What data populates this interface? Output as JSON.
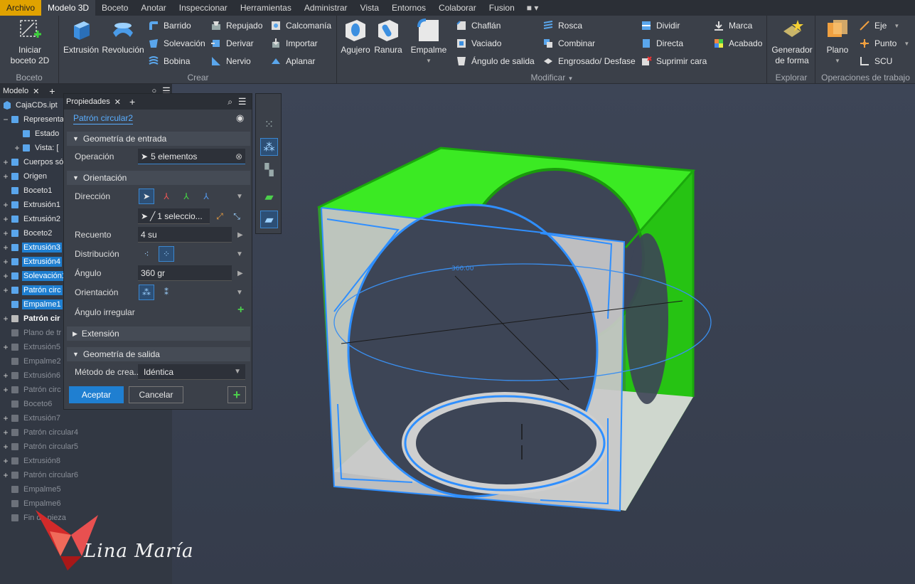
{
  "menu": {
    "items": [
      "Archivo",
      "Modelo 3D",
      "Boceto",
      "Anotar",
      "Inspeccionar",
      "Herramientas",
      "Administrar",
      "Vista",
      "Entornos",
      "Colaborar",
      "Fusion"
    ],
    "active": "Modelo 3D"
  },
  "ribbon": {
    "boceto": {
      "label": "Boceto",
      "start_sketch_line1": "Iniciar",
      "start_sketch_line2": "boceto 2D"
    },
    "crear": {
      "label": "Crear",
      "extrusion": "Extrusión",
      "revolucion": "Revolución",
      "barrido": "Barrido",
      "solevacion": "Solevación",
      "bobina": "Bobina",
      "repujado": "Repujado",
      "derivar": "Derivar",
      "nervio": "Nervio",
      "calcomania": "Calcomanía",
      "importar": "Importar",
      "aplanar": "Aplanar"
    },
    "modificar": {
      "label": "Modificar",
      "agujero": "Agujero",
      "ranura": "Ranura",
      "empalme": "Empalme",
      "chaflan": "Chaflán",
      "vaciado": "Vaciado",
      "angulo_salida": "Ángulo de salida",
      "rosca": "Rosca",
      "combinar": "Combinar",
      "engrosado": "Engrosado/ Desfase",
      "dividir": "Dividir",
      "directa": "Directa",
      "suprimir_cara": "Suprimir cara",
      "marca": "Marca",
      "acabado": "Acabado"
    },
    "explorar": {
      "label": "Explorar",
      "generador_line1": "Generador",
      "generador_line2": "de forma"
    },
    "trabajo": {
      "label": "Operaciones de trabajo",
      "plano": "Plano",
      "eje": "Eje",
      "punto": "Punto",
      "scu": "SCU"
    }
  },
  "browser": {
    "tab": "Modelo",
    "file": "CajaCDs.ipt",
    "rows": [
      {
        "exp": "−",
        "indent": 0,
        "label": "Representa",
        "state": "normal"
      },
      {
        "exp": "",
        "indent": 1,
        "label": "Estado",
        "state": "normal"
      },
      {
        "exp": "+",
        "indent": 1,
        "label": "Vista: [",
        "state": "normal"
      },
      {
        "exp": "+",
        "indent": 0,
        "label": "Cuerpos só",
        "state": "normal"
      },
      {
        "exp": "+",
        "indent": 0,
        "label": "Origen",
        "state": "normal"
      },
      {
        "exp": "",
        "indent": 0,
        "label": "Boceto1",
        "state": "normal"
      },
      {
        "exp": "+",
        "indent": 0,
        "label": "Extrusión1",
        "state": "normal"
      },
      {
        "exp": "+",
        "indent": 0,
        "label": "Extrusión2",
        "state": "normal"
      },
      {
        "exp": "+",
        "indent": 0,
        "label": "Boceto2",
        "state": "normal"
      },
      {
        "exp": "+",
        "indent": 0,
        "label": "Extrusión3",
        "state": "sel"
      },
      {
        "exp": "+",
        "indent": 0,
        "label": "Extrusión4",
        "state": "sel"
      },
      {
        "exp": "+",
        "indent": 0,
        "label": "Solevación1",
        "state": "sel"
      },
      {
        "exp": "+",
        "indent": 0,
        "label": "Patrón circ",
        "state": "sel"
      },
      {
        "exp": "",
        "indent": 0,
        "label": "Empalme1",
        "state": "sel"
      },
      {
        "exp": "+",
        "indent": 0,
        "label": "Patrón cir",
        "state": "bold"
      },
      {
        "exp": "",
        "indent": 0,
        "label": "Plano de tr",
        "state": "dim"
      },
      {
        "exp": "+",
        "indent": 0,
        "label": "Extrusión5",
        "state": "dim"
      },
      {
        "exp": "",
        "indent": 0,
        "label": "Empalme2",
        "state": "dim"
      },
      {
        "exp": "+",
        "indent": 0,
        "label": "Extrusión6",
        "state": "dim"
      },
      {
        "exp": "+",
        "indent": 0,
        "label": "Patrón circ",
        "state": "dim"
      },
      {
        "exp": "",
        "indent": 0,
        "label": "Boceto6",
        "state": "dim"
      },
      {
        "exp": "+",
        "indent": 0,
        "label": "Extrusión7",
        "state": "dim"
      },
      {
        "exp": "+",
        "indent": 0,
        "label": "Patrón circular4",
        "state": "dim"
      },
      {
        "exp": "+",
        "indent": 0,
        "label": "Patrón circular5",
        "state": "dim"
      },
      {
        "exp": "+",
        "indent": 0,
        "label": "Extrusión8",
        "state": "dim"
      },
      {
        "exp": "+",
        "indent": 0,
        "label": "Patrón circular6",
        "state": "dim"
      },
      {
        "exp": "",
        "indent": 0,
        "label": "Empalme5",
        "state": "dim"
      },
      {
        "exp": "",
        "indent": 0,
        "label": "Empalme6",
        "state": "dim"
      },
      {
        "exp": "",
        "indent": 0,
        "label": "Fin de pieza",
        "state": "dim"
      }
    ]
  },
  "properties": {
    "tab": "Propiedades",
    "feature_name": "Patrón circular2",
    "input_section": "Geometría de entrada",
    "operation_label": "Operación",
    "operation_value": "5 elementos",
    "orientation_section": "Orientación",
    "direction_label": "Dirección",
    "axis_value": "1 seleccio...",
    "count_label": "Recuento",
    "count_value": "4 su",
    "distribution_label": "Distribución",
    "angle_label": "Ángulo",
    "angle_value": "360 gr",
    "orientation_label": "Orientación",
    "irregular_label": "Ángulo irregular",
    "extension_section": "Extensión",
    "output_section": "Geometría de salida",
    "method_label": "Método de crea...",
    "method_value": "Idéntica",
    "accept": "Aceptar",
    "cancel": "Cancelar"
  },
  "viewport": {
    "dimension_label": "360.00"
  },
  "watermark": {
    "text": "Lina María"
  },
  "colors": {
    "accent": "#1f7fd1",
    "file_tab": "#e0a200",
    "green": "#2ee016",
    "highlight": "#2f8fff"
  }
}
